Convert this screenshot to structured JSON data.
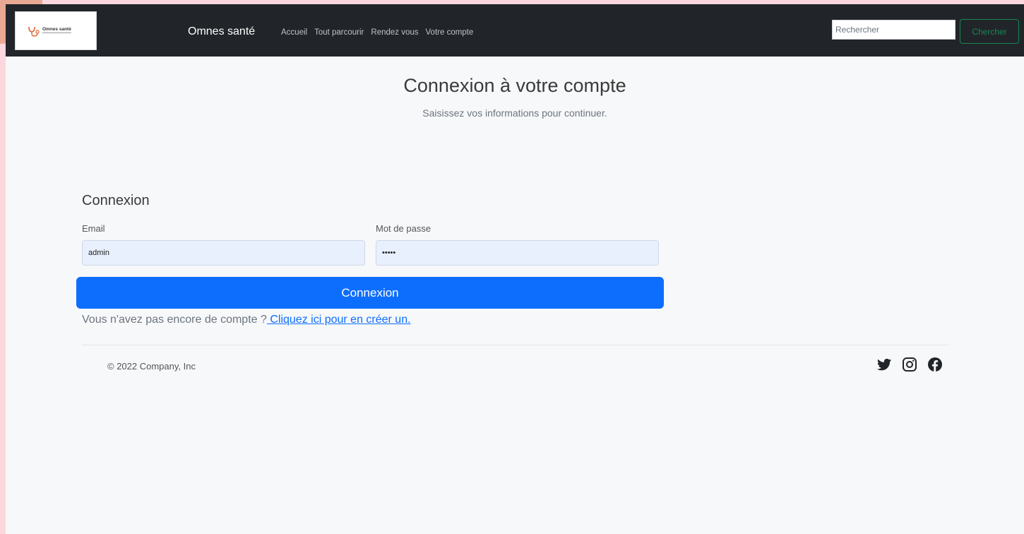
{
  "navbar": {
    "logo_text": "Omnes santé",
    "brand": "Omnes santé",
    "links": [
      {
        "label": "Accueil"
      },
      {
        "label": "Tout parcourir"
      },
      {
        "label": "Rendez vous"
      },
      {
        "label": "Votre compte"
      }
    ],
    "search": {
      "placeholder": "Rechercher",
      "button_label": "Chercher"
    }
  },
  "header": {
    "title": "Connexion à votre compte",
    "subtitle": "Saisissez vos informations pour continuer."
  },
  "login": {
    "section_title": "Connexion",
    "email_label": "Email",
    "email_value": "admin",
    "password_label": "Mot de passe",
    "password_value": "admin",
    "submit_label": "Connexion",
    "signup_text": "Vous n'avez pas encore de compte ?",
    "signup_link": " Cliquez ici pour en créer un."
  },
  "footer": {
    "copyright": "© 2022 Company, Inc",
    "social": [
      "twitter-icon",
      "instagram-icon",
      "facebook-icon"
    ]
  },
  "colors": {
    "navbar_bg": "#212529",
    "primary": "#0d6efd",
    "success": "#198754",
    "page_bg": "#f7f8fa",
    "outer_bg": "#fbd7de"
  }
}
